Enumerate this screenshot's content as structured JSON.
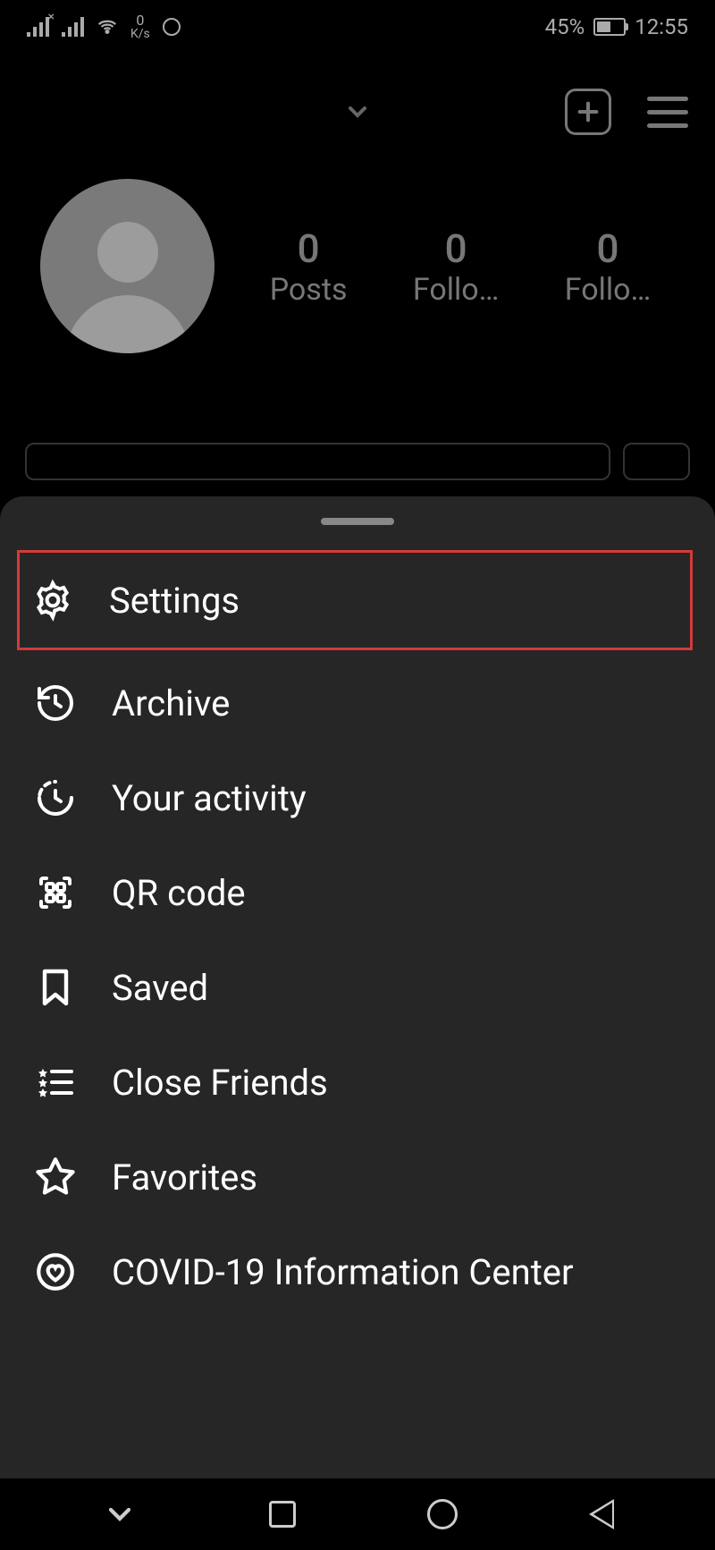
{
  "status_bar": {
    "data_rate_num": "0",
    "data_rate_unit": "K/s",
    "battery_percent": "45%",
    "time": "12:55"
  },
  "profile": {
    "posts_count": "0",
    "posts_label": "Posts",
    "followers_count": "0",
    "followers_label": "Follo…",
    "following_count": "0",
    "following_label": "Follo…"
  },
  "menu": {
    "settings": "Settings",
    "archive": "Archive",
    "activity": "Your activity",
    "qr": "QR code",
    "saved": "Saved",
    "close_friends": "Close Friends",
    "favorites": "Favorites",
    "covid": "COVID-19 Information Center"
  }
}
